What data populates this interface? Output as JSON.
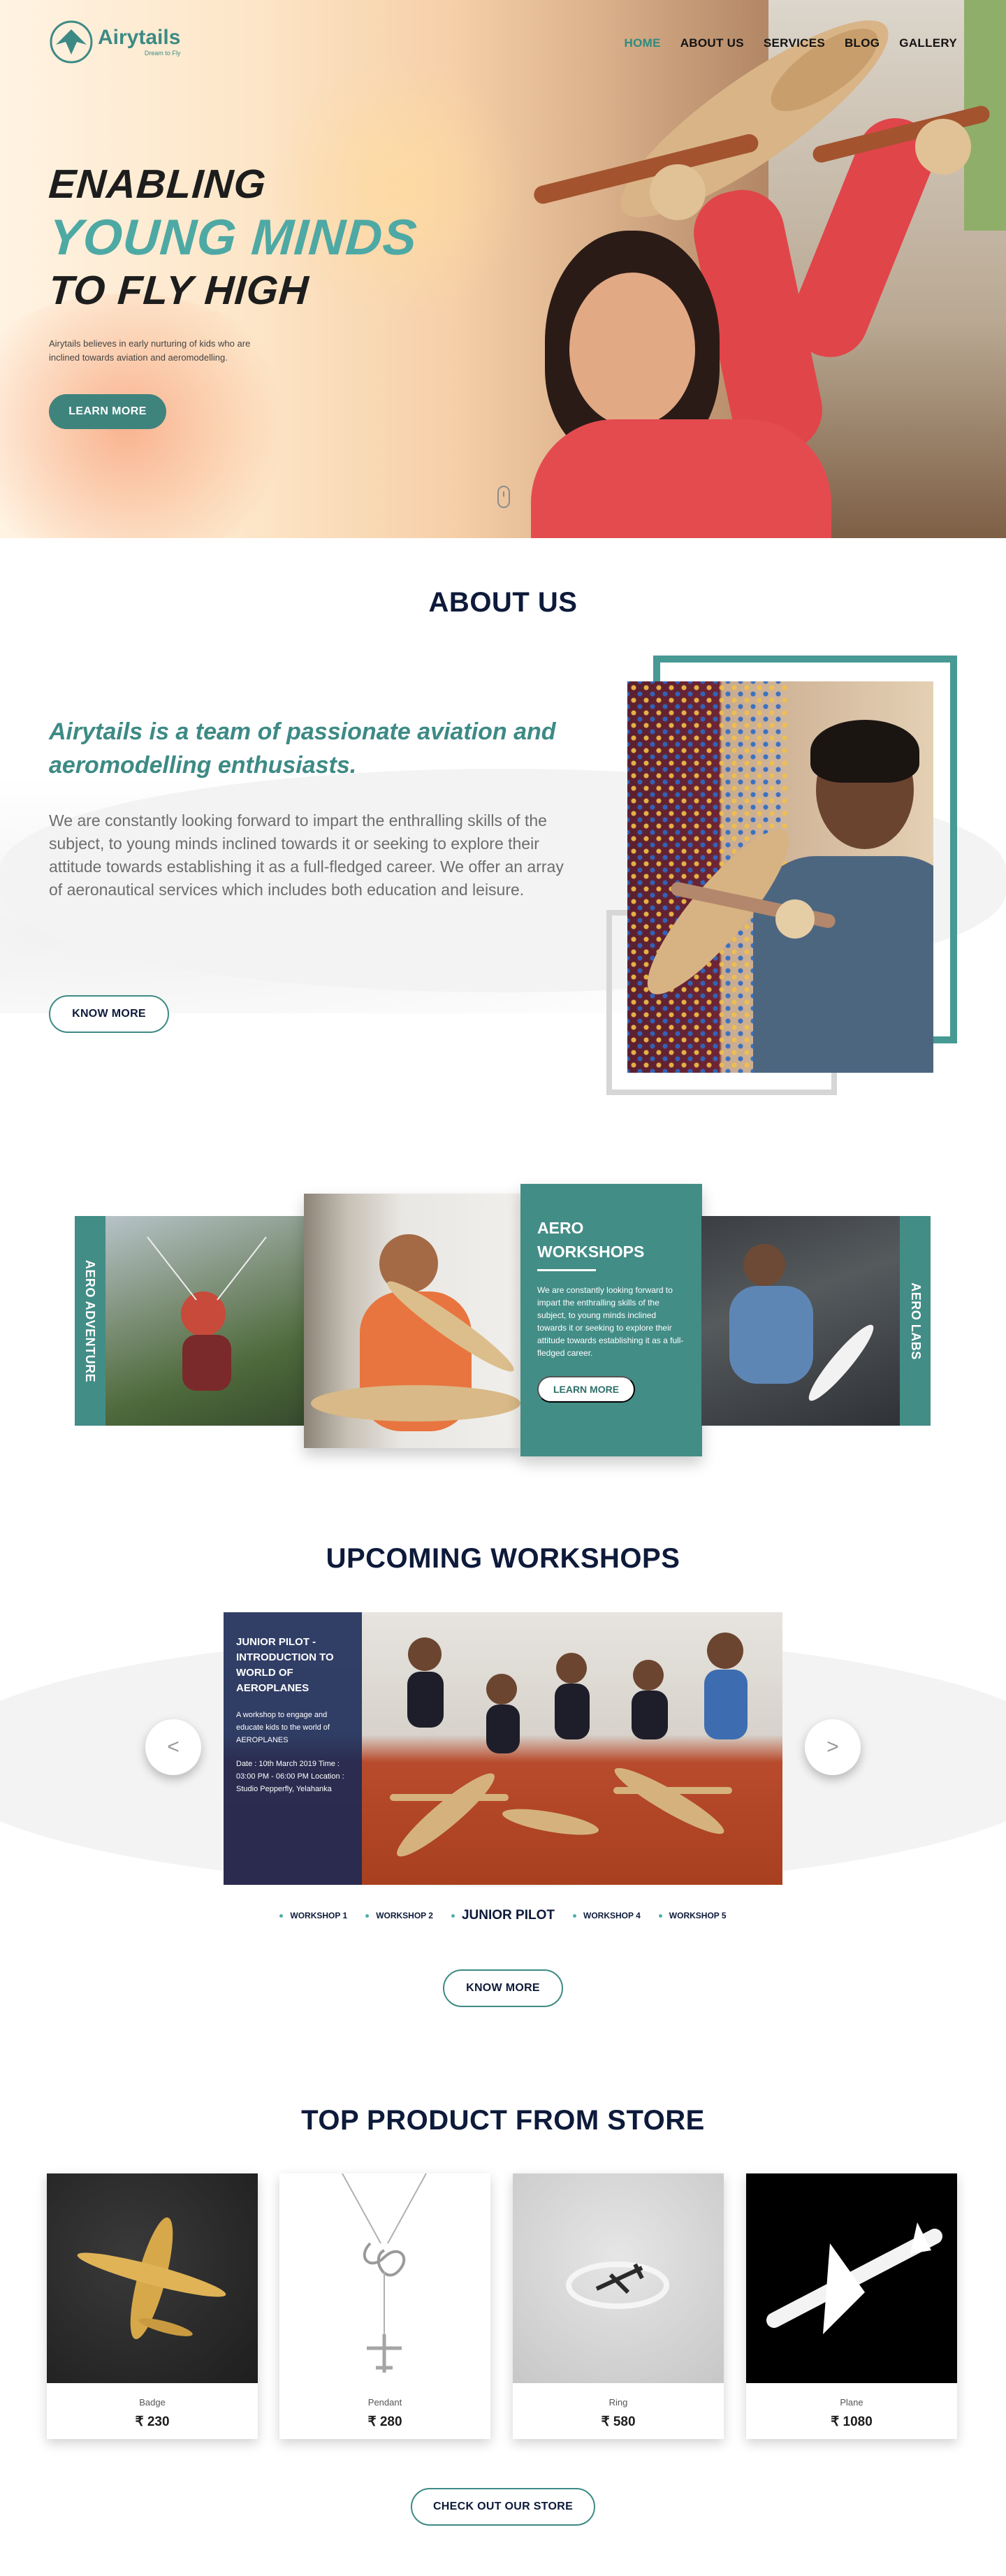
{
  "brand": {
    "name": "Airytails",
    "tagline": "Dream to Fly",
    "accent": "#3d8a85"
  },
  "nav": [
    {
      "label": "HOME",
      "active": true
    },
    {
      "label": "ABOUT US",
      "active": false
    },
    {
      "label": "SERVICES",
      "active": false
    },
    {
      "label": "BLOG",
      "active": false
    },
    {
      "label": "GALLERY",
      "active": false
    }
  ],
  "hero": {
    "line1": "ENABLING",
    "line2": "YOUNG MINDS",
    "line3": "TO FLY HIGH",
    "description": "Airytails believes in early nurturing of kids who are inclined towards aviation and aeromodelling.",
    "button": "LEARN MORE"
  },
  "about": {
    "title": "ABOUT US",
    "lead": "Airytails is a team of passionate aviation and aeromodelling enthusiasts.",
    "body": "We are constantly looking forward to impart the enthralling skills of the subject, to young minds inclined towards it or seeking to explore their attitude towards establishing it as a full-fledged career. We offer an array of aeronautical services which includes both education and leisure.",
    "button": "KNOW MORE"
  },
  "services": {
    "left_label": "AERO ADVENTURE",
    "right_label": "AERO LABS",
    "card_title": "AERO WORKSHOPS",
    "card_desc": "We are constantly looking forward to impart the enthralling skills of the subject, to young minds inclined towards it or seeking to explore their attitude towards establishing it as a full-fledged career.",
    "card_button": "LEARN MORE"
  },
  "workshops": {
    "title": "UPCOMING WORKSHOPS",
    "slide_title": "JUNIOR PILOT - INTRODUCTION TO WORLD OF AEROPLANES",
    "slide_desc": "A workshop to engage and educate kids to the world of AEROPLANES",
    "slide_meta": "Date : 10th March 2019 Time : 03:00 PM - 06:00 PM Location : Studio Pepperfly, Yelahanka",
    "prev": "<",
    "next": ">",
    "tabs": [
      {
        "label": "WORKSHOP 1",
        "active": false
      },
      {
        "label": "WORKSHOP 2",
        "active": false
      },
      {
        "label": "JUNIOR PILOT",
        "active": true
      },
      {
        "label": "WORKSHOP 4",
        "active": false
      },
      {
        "label": "WORKSHOP 5",
        "active": false
      }
    ],
    "button": "KNOW MORE"
  },
  "store": {
    "title": "TOP PRODUCT FROM STORE",
    "products": [
      {
        "name": "Badge",
        "price": "₹ 230"
      },
      {
        "name": "Pendant",
        "price": "₹ 280"
      },
      {
        "name": "Ring",
        "price": "₹ 580"
      },
      {
        "name": "Plane",
        "price": "₹ 1080"
      }
    ],
    "button": "CHECK OUT OUR STORE"
  }
}
